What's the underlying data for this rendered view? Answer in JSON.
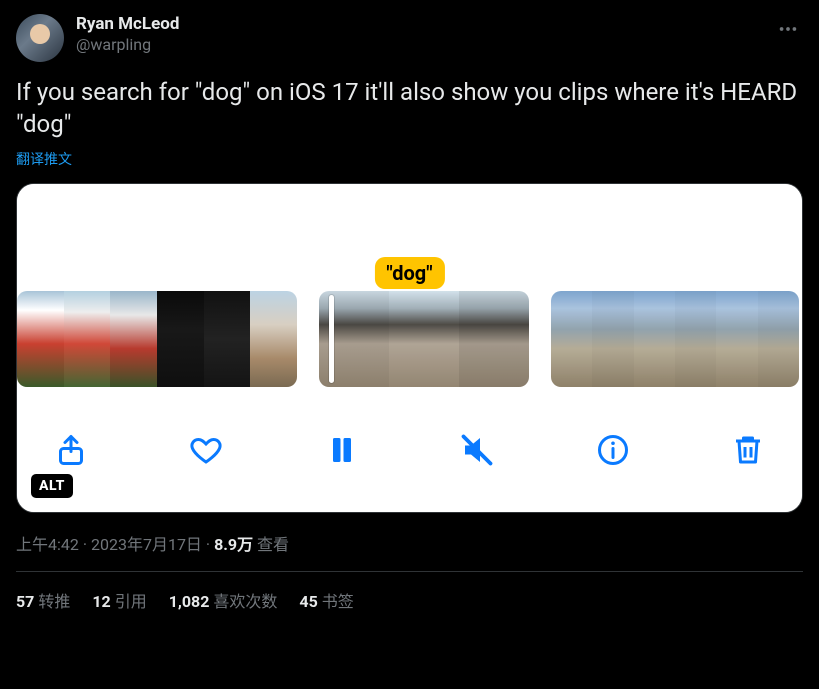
{
  "author": {
    "display_name": "Ryan McLeod",
    "handle": "@warpling"
  },
  "tweet_text": "If you search for \"dog\" on iOS 17 it'll also show you clips where it's HEARD \"dog\"",
  "translate_label": "翻译推文",
  "media": {
    "keyword_label": "\"dog\"",
    "alt_badge": "ALT"
  },
  "meta": {
    "time": "上午4:42",
    "separator": " · ",
    "date": "2023年7月17日",
    "views_count": "8.9万",
    "views_label": " 查看"
  },
  "stats": {
    "retweets_count": "57",
    "retweets_label": "转推",
    "quotes_count": "12",
    "quotes_label": "引用",
    "likes_count": "1,082",
    "likes_label": "喜欢次数",
    "bookmarks_count": "45",
    "bookmarks_label": "书签"
  }
}
